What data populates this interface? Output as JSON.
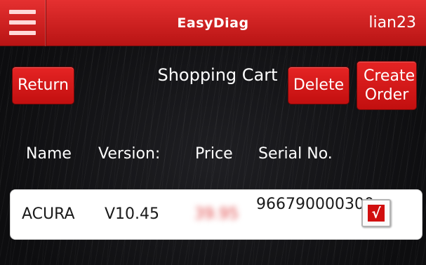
{
  "header": {
    "app_title": "EasyDiag",
    "user": "lian23",
    "menu_icon": "hamburger-menu-icon"
  },
  "toolbar": {
    "return_label": "Return",
    "page_title": "Shopping Cart",
    "delete_label": "Delete",
    "create_order_label": "Create Order"
  },
  "table": {
    "columns": [
      "Name",
      "Version:",
      "Price",
      "Serial No."
    ],
    "rows": [
      {
        "name": "ACURA",
        "version": "V10.45",
        "price": "39.95",
        "serial": "966790000300",
        "selected": true
      }
    ]
  },
  "colors": {
    "accent": "#d11a1a",
    "header_bg": "#c81818",
    "background": "#0d0d0f"
  }
}
